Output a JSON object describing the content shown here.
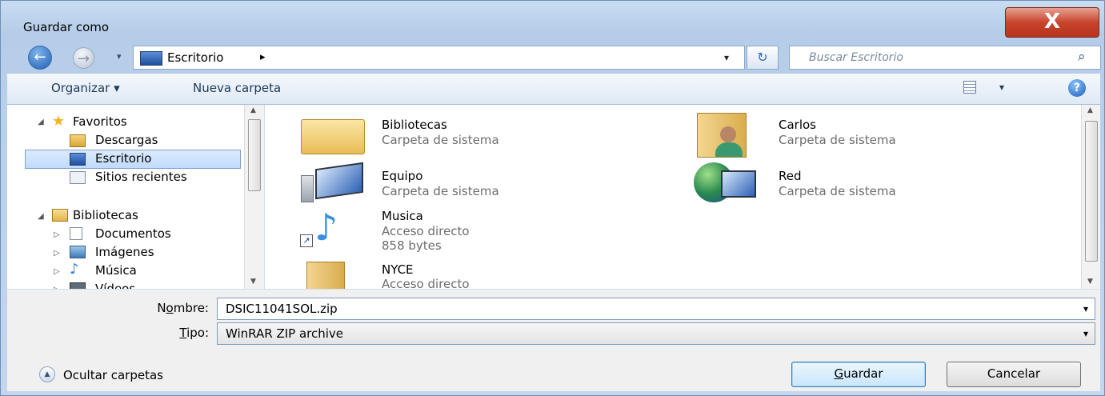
{
  "window": {
    "title": "Guardar como",
    "close_glyph": "X"
  },
  "address": {
    "location": "Escritorio",
    "separator": "▸",
    "dropdown": "▾",
    "refresh_glyph": "↻",
    "search_placeholder": "Buscar Escritorio"
  },
  "toolbar": {
    "organize": "Organizar ▾",
    "new_folder": "Nueva carpeta",
    "view_dropdown": "▾",
    "help_glyph": "?"
  },
  "sidebar": {
    "favorites_label": "Favoritos",
    "favorites": [
      "Descargas",
      "Escritorio",
      "Sitios recientes"
    ],
    "libraries_label": "Bibliotecas",
    "libraries": [
      "Documentos",
      "Imágenes",
      "Música",
      "Vídeos"
    ],
    "expand_open": "◢",
    "expand_closed": "▷"
  },
  "items": [
    {
      "name": "Bibliotecas",
      "desc": "Carpeta de sistema",
      "icon": "libraries-folder-icon"
    },
    {
      "name": "Carlos",
      "desc": "Carpeta de sistema",
      "icon": "user-folder-icon"
    },
    {
      "name": "Equipo",
      "desc": "Carpeta de sistema",
      "icon": "computer-icon"
    },
    {
      "name": "Red",
      "desc": "Carpeta de sistema",
      "icon": "network-icon"
    },
    {
      "name": "Musica",
      "desc": "Acceso directo",
      "size": "858 bytes",
      "icon": "music-shortcut-icon"
    },
    {
      "name": "NYCE",
      "desc": "Acceso directo",
      "icon": "folder-shortcut-icon"
    }
  ],
  "form": {
    "name_label_pre": "N",
    "name_label_u": "o",
    "name_label_post": "mbre:",
    "name_value": "DSIC11041SOL.zip",
    "type_label_u": "T",
    "type_label_post": "ipo:",
    "type_value": "WinRAR ZIP archive",
    "dropdown": "▾"
  },
  "footer": {
    "hide_folders": "Ocultar carpetas",
    "hide_glyph": "▲",
    "save_u": "G",
    "save_rest": "uardar",
    "cancel": "Cancelar"
  },
  "colors": {
    "accent": "#3c7fb1",
    "close_button": "#c7452d",
    "selection": "#c1dbfc"
  }
}
